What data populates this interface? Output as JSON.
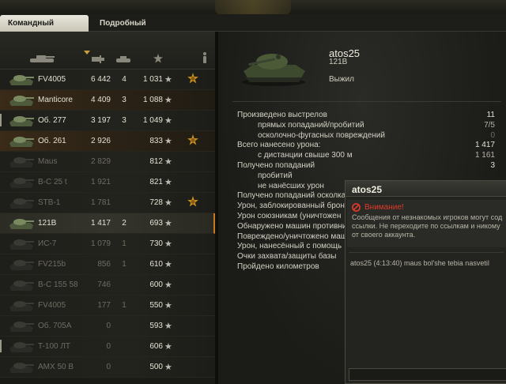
{
  "tabs": [
    {
      "label": "Командный результат"
    },
    {
      "label": "Подробный отчёт"
    }
  ],
  "table": {
    "columns": [
      "tank-icon",
      "damage-icon",
      "kills-icon",
      "experience-icon",
      "medal-icon"
    ],
    "rows": [
      {
        "name": "FV4005",
        "damage": "6 442",
        "kills": "4",
        "xp": "1 031",
        "medal": true,
        "state": "alive"
      },
      {
        "name": "Manticore",
        "damage": "4 409",
        "kills": "3",
        "xp": "1 088",
        "medal": false,
        "state": "alive-hl"
      },
      {
        "name": "Об. 277",
        "damage": "3 197",
        "kills": "3",
        "xp": "1 049",
        "medal": false,
        "state": "alive"
      },
      {
        "name": "Об. 261",
        "damage": "2 926",
        "kills": "",
        "xp": "833",
        "medal": true,
        "state": "alive-hl"
      },
      {
        "name": "Maus",
        "damage": "2 829",
        "kills": "",
        "xp": "812",
        "medal": false,
        "state": "dead"
      },
      {
        "name": "B-C 25 t",
        "damage": "1 921",
        "kills": "",
        "xp": "821",
        "medal": false,
        "state": "dead"
      },
      {
        "name": "STB-1",
        "damage": "1 781",
        "kills": "",
        "xp": "728",
        "medal": true,
        "state": "dead"
      },
      {
        "name": "121B",
        "damage": "1 417",
        "kills": "2",
        "xp": "693",
        "medal": false,
        "state": "self"
      },
      {
        "name": "ИС-7",
        "damage": "1 079",
        "kills": "1",
        "xp": "730",
        "medal": false,
        "state": "dead"
      },
      {
        "name": "FV215b",
        "damage": "856",
        "kills": "1",
        "xp": "610",
        "medal": false,
        "state": "dead"
      },
      {
        "name": "B-C 155 58",
        "damage": "746",
        "kills": "",
        "xp": "600",
        "medal": false,
        "state": "dead"
      },
      {
        "name": "FV4005",
        "damage": "177",
        "kills": "1",
        "xp": "550",
        "medal": false,
        "state": "dead"
      },
      {
        "name": "Об. 705А",
        "damage": "0",
        "kills": "",
        "xp": "593",
        "medal": false,
        "state": "dead"
      },
      {
        "name": "T-100 ЛТ",
        "damage": "0",
        "kills": "",
        "xp": "606",
        "medal": false,
        "state": "dead"
      },
      {
        "name": "AMX 50 B",
        "damage": "0",
        "kills": "",
        "xp": "500",
        "medal": false,
        "state": "dead"
      }
    ]
  },
  "player": {
    "name": "atos25",
    "tank": "121B",
    "status": "Выжил"
  },
  "stats": [
    {
      "label": "Произведено выстрелов",
      "value": "11",
      "sub": false
    },
    {
      "label": "прямых попаданий/пробитий",
      "value": "7/5",
      "sub": true
    },
    {
      "label": "осколочно-фугасных повреждений",
      "value": "0",
      "sub": true,
      "dim": true
    },
    {
      "label": "Всего нанесено урона:",
      "value": "1 417",
      "sub": false
    },
    {
      "label": "с дистанции свыше 300 м",
      "value": "1 161",
      "sub": true
    },
    {
      "label": "Получено попаданий",
      "value": "3",
      "sub": false
    },
    {
      "label": "пробитий",
      "value": "",
      "sub": true
    },
    {
      "label": "не нанёсших урон",
      "value": "",
      "sub": true
    },
    {
      "label": "Получено попаданий осколка",
      "value": "",
      "sub": false
    },
    {
      "label": "Урон, заблокированный брон",
      "value": "",
      "sub": false
    },
    {
      "label": "Урон союзникам (уничтожен",
      "value": "",
      "sub": false
    },
    {
      "label": "Обнаружено машин противни",
      "value": "",
      "sub": false
    },
    {
      "label": "Повреждено/уничтожено маши",
      "value": "",
      "sub": false
    },
    {
      "label": "Урон, нанесённый с помощь",
      "value": "",
      "sub": false
    },
    {
      "label": "Очки захвата/защиты базы",
      "value": "",
      "sub": false
    },
    {
      "label": "Пройдено километров",
      "value": "",
      "sub": false
    }
  ],
  "chat": {
    "title": "atos25",
    "warning_title": "Внимание!",
    "warning_text": "Сообщения от незнакомых игроков могут сод\nссылки. Не переходите по ссылкам и никому\nот своего аккаунта.",
    "message": "atos25 (4:13:40) maus bol'she tebia nasvetil",
    "input_value": ""
  }
}
